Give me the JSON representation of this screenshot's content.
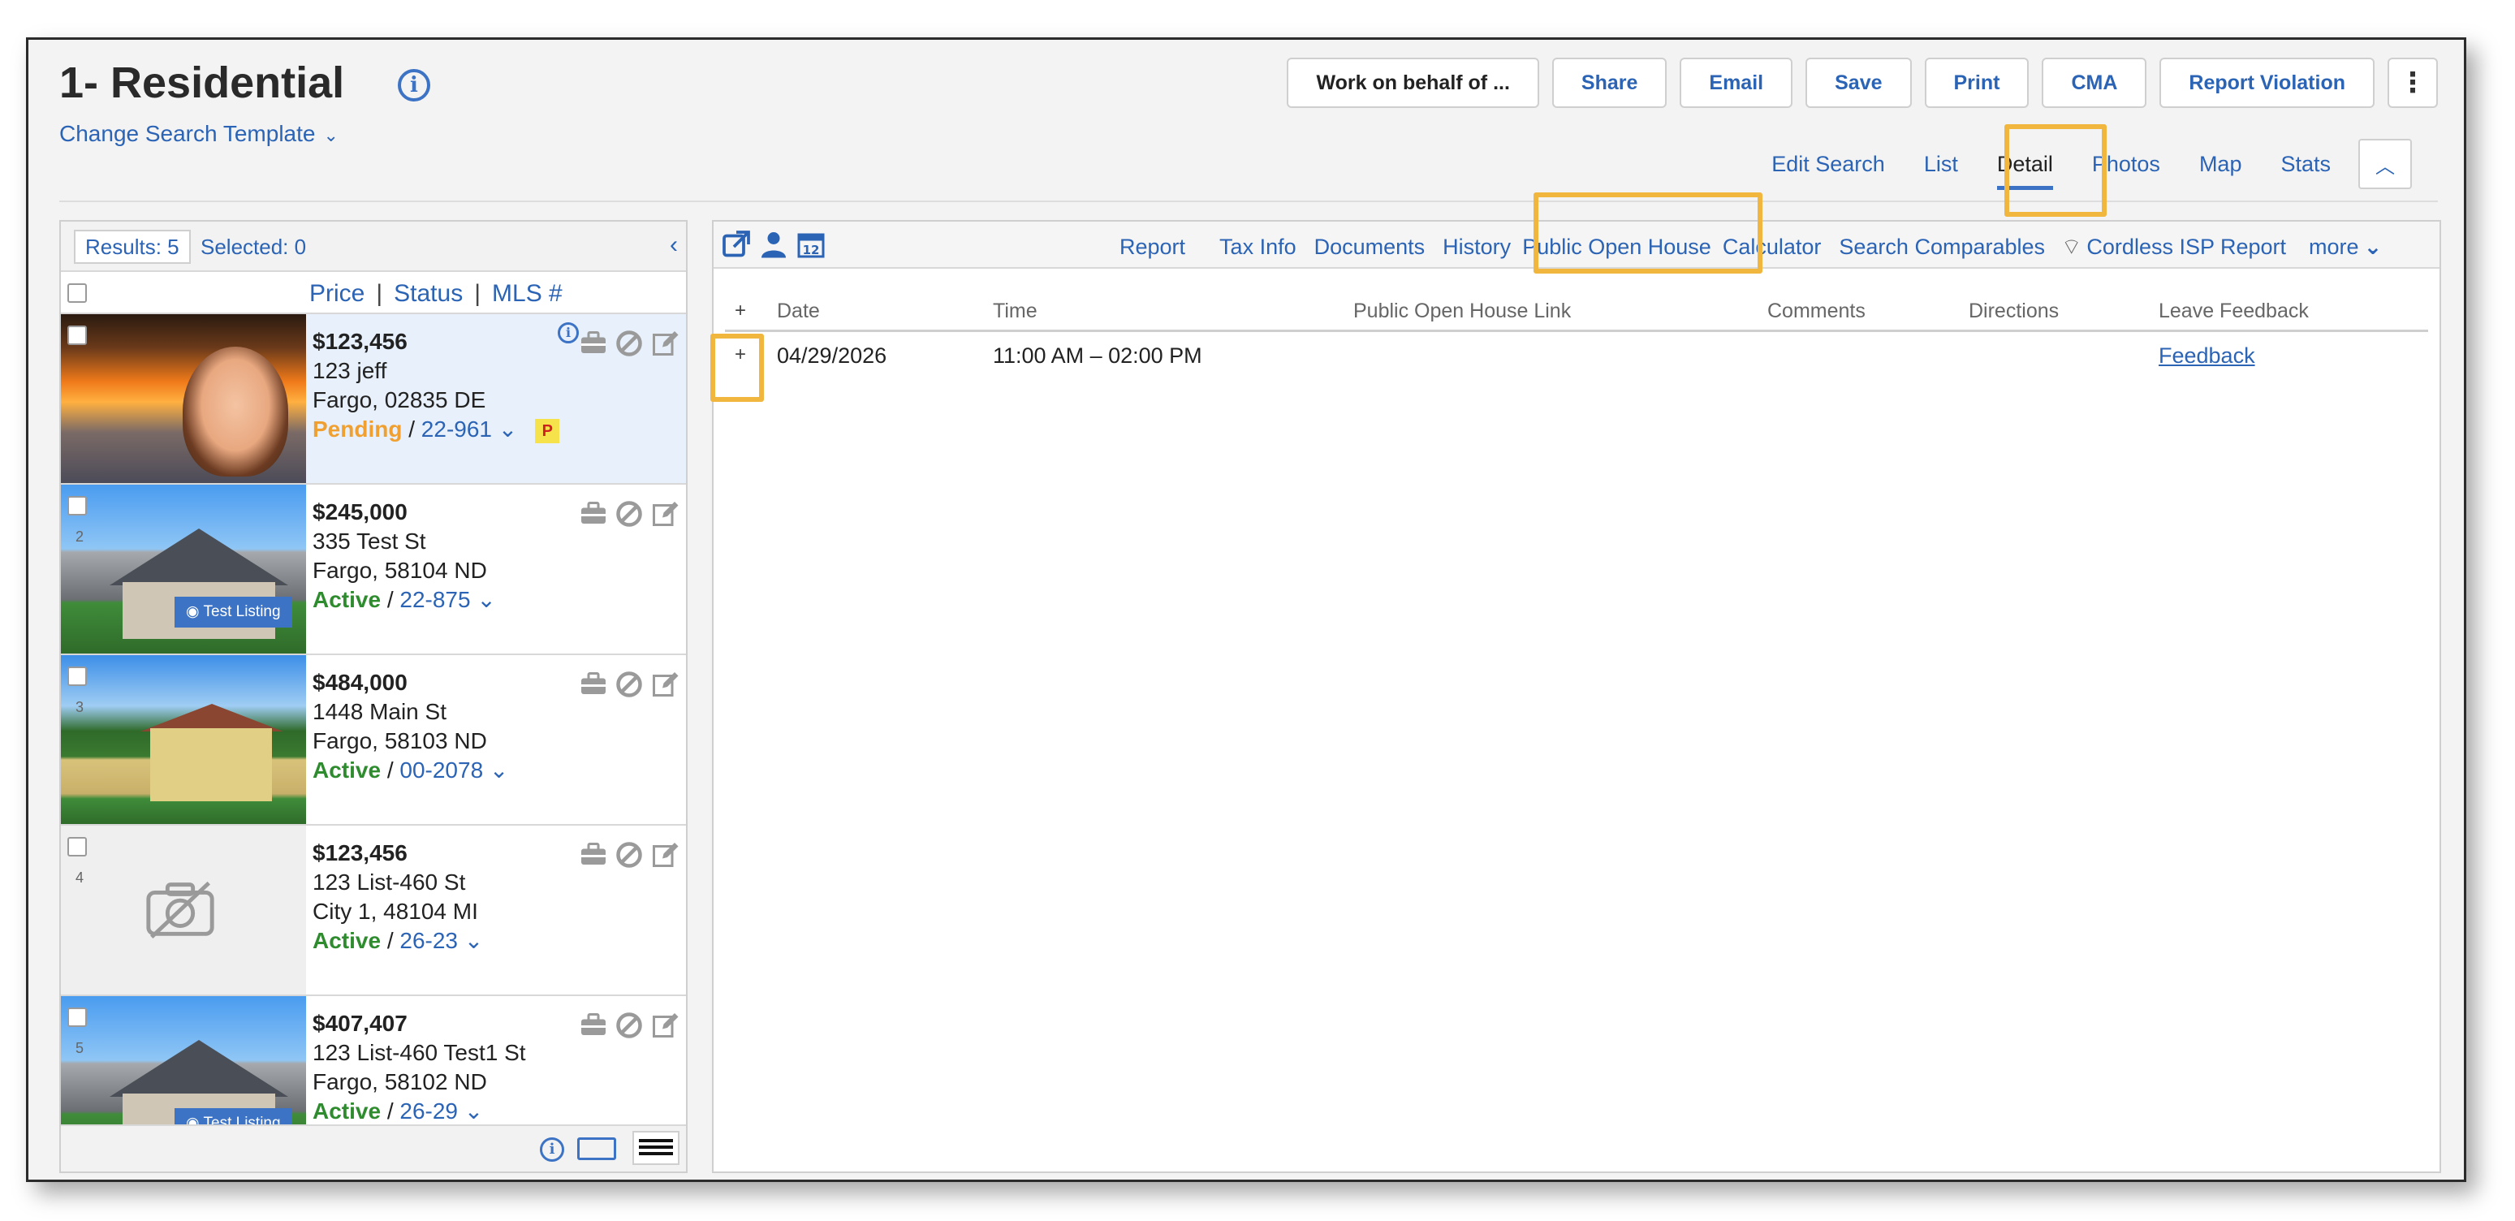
{
  "page": {
    "title": "1- Residential",
    "change_template": "Change Search Template"
  },
  "top_buttons": {
    "work_on_behalf": "Work on behalf of ...",
    "share": "Share",
    "email": "Email",
    "save": "Save",
    "print": "Print",
    "cma": "CMA",
    "report_violation": "Report Violation"
  },
  "view_tabs": [
    "Edit Search",
    "List",
    "Detail",
    "Photos",
    "Map",
    "Stats"
  ],
  "view_tabs_active": "Detail",
  "left_panel": {
    "results_label": "Results: 5",
    "selected_label": "Selected: 0",
    "sort": {
      "price": "Price",
      "sep": "|",
      "status": "Status",
      "mls": "MLS #"
    },
    "listings": [
      {
        "num": "",
        "price": "$123,456",
        "address": "123 jeff",
        "city": "Fargo, 02835 DE",
        "status": "Pending",
        "mls": "22-961",
        "badge": "P",
        "photo": "fire",
        "has_info": true
      },
      {
        "num": "2",
        "price": "$245,000",
        "address": "335 Test St",
        "city": "Fargo, 58104 ND",
        "status": "Active",
        "mls": "22-875",
        "photo": "house",
        "tag": "Test Listing"
      },
      {
        "num": "3",
        "price": "$484,000",
        "address": "1448 Main St",
        "city": "Fargo, 58103 ND",
        "status": "Active",
        "mls": "00-2078",
        "photo": "yellow"
      },
      {
        "num": "4",
        "price": "$123,456",
        "address": "123 List-460 St",
        "city": "City 1, 48104 MI",
        "status": "Active",
        "mls": "26-23",
        "photo": "none"
      },
      {
        "num": "5",
        "price": "$407,407",
        "address": "123 List-460 Test1 St",
        "city": "Fargo, 58102 ND",
        "status": "Active",
        "mls": "26-29",
        "photo": "house",
        "tag": "Test Listing"
      }
    ]
  },
  "detail_links": [
    "Report",
    "Tax Info",
    "Documents",
    "History",
    "Public Open House",
    "Calculator",
    "Search Comparables",
    "Cordless ISP Report",
    "more"
  ],
  "detail_links_active": "Public Open House",
  "table": {
    "headers": {
      "plus": "+",
      "date": "Date",
      "time": "Time",
      "link": "Public Open House Link",
      "comments": "Comments",
      "directions": "Directions",
      "feedback": "Leave Feedback"
    },
    "rows": [
      {
        "plus": "+",
        "date": "04/29/2026",
        "time": "11:00 AM – 02:00 PM",
        "link": "",
        "comments": "",
        "directions": "",
        "feedback": "Feedback"
      }
    ]
  },
  "colors": {
    "accent": "#2b63b5",
    "highlight": "#f0b63d",
    "active": "#2e8b2e",
    "pending": "#f0a030"
  }
}
